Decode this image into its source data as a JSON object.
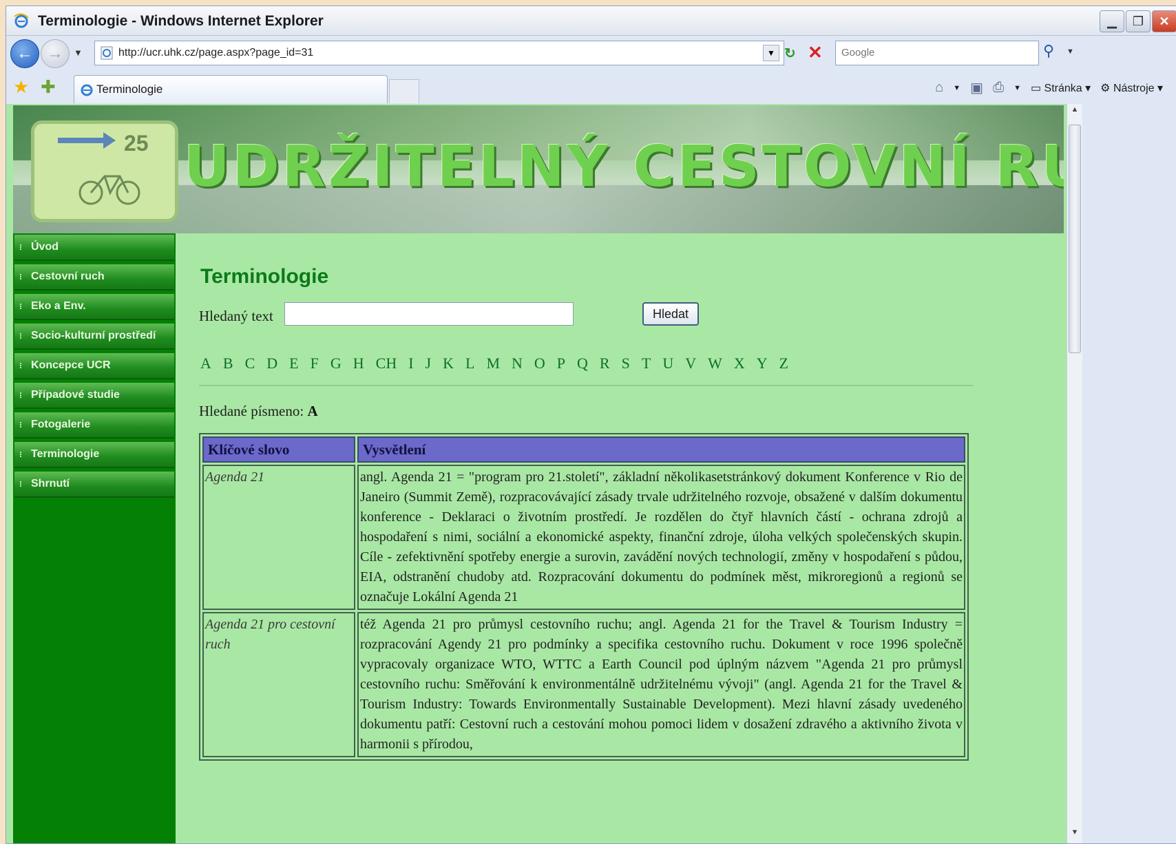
{
  "window": {
    "title": "Terminologie - Windows Internet Explorer"
  },
  "address_bar": {
    "url": "http://ucr.uhk.cz/page.aspx?page_id=31",
    "search_placeholder": "Google"
  },
  "tab": {
    "label": "Terminologie"
  },
  "command_bar": {
    "page_label": "Stránka",
    "tools_label": "Nástroje"
  },
  "banner": {
    "headline": "UDRŽITELNÝ CESTOVNÍ RUCH",
    "sign_number": "25"
  },
  "sidebar": {
    "items": [
      {
        "label": "Úvod"
      },
      {
        "label": "Cestovní ruch"
      },
      {
        "label": "Eko a Env."
      },
      {
        "label": "Socio-kulturní prostředí"
      },
      {
        "label": "Koncepce UCR"
      },
      {
        "label": "Případové studie"
      },
      {
        "label": "Fotogalerie"
      },
      {
        "label": "Terminologie"
      },
      {
        "label": "Shrnutí"
      }
    ]
  },
  "main": {
    "title": "Terminologie",
    "search_label": "Hledaný text",
    "search_value": "",
    "search_button": "Hledat",
    "letters": [
      "A",
      "B",
      "C",
      "D",
      "E",
      "F",
      "G",
      "H",
      "CH",
      "I",
      "J",
      "K",
      "L",
      "M",
      "N",
      "O",
      "P",
      "Q",
      "R",
      "S",
      "T",
      "U",
      "V",
      "W",
      "X",
      "Y",
      "Z"
    ],
    "chosen_label": "Hledané písmeno:",
    "chosen_letter": "A",
    "table": {
      "headers": [
        "Klíčové slovo",
        "Vysvětlení"
      ],
      "rows": [
        {
          "keyword": "Agenda 21",
          "explanation": "angl. Agenda 21 = \"program pro 21.století\", základní několikasetstránkový dokument Konference v Rio de Janeiro (Summit Země), rozpracovávající zásady trvale udržitelného rozvoje, obsažené v dalším dokumentu konference - Deklaraci o životním prostředí. Je rozdělen do čtyř hlavních částí - ochrana zdrojů a hospodaření s nimi, sociální a ekonomické aspekty, finanční zdroje, úloha velkých společenských skupin. Cíle - zefektivnění spotřeby energie a surovin, zavádění nových technologií, změny v hospodaření s půdou, EIA, odstranění chudoby atd. Rozpracování dokumentu do podmínek měst, mikroregionů a regionů se označuje Lokální Agenda 21"
        },
        {
          "keyword": "Agenda 21 pro cestovní ruch",
          "explanation": "též Agenda 21 pro průmysl cestovního ruchu; angl. Agenda 21 for the Travel & Tourism Industry = rozpracování Agendy 21 pro podmínky a specifika cestovního ruchu. Dokument v roce 1996 společně vypracovaly organizace WTO, WTTC a Earth Council pod úplným názvem \"Agenda 21 pro průmysl cestovního ruchu: Směřování k environmentálně udržitelnému vývoji\" (angl. Agenda 21 for the Travel & Tourism Industry: Towards Environmentally Sustainable Development). Mezi hlavní zásady uvedeného dokumentu patří: Cestovní ruch a cestování mohou pomoci lidem v dosažení zdravého a aktivního života v harmonii s přírodou,"
        }
      ]
    }
  }
}
